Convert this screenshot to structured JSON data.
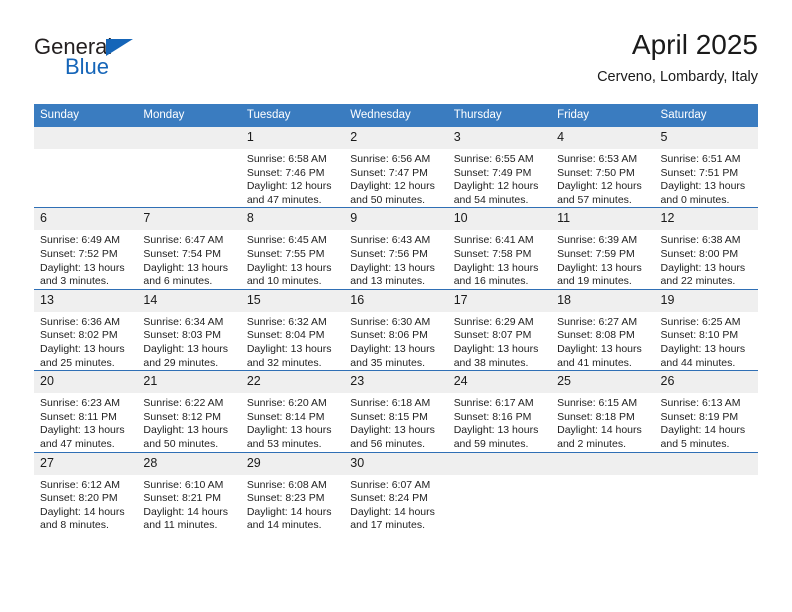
{
  "brand": {
    "name_part1": "General",
    "name_part2": "Blue",
    "triangle_color": "#1565b8"
  },
  "header": {
    "title": "April 2025",
    "subtitle": "Cerveno, Lombardy, Italy"
  },
  "theme": {
    "header_blue": "#3a7cc0",
    "divider_blue": "#2f6fb5",
    "daynum_band": "#efefef"
  },
  "weekday_headers": [
    "Sunday",
    "Monday",
    "Tuesday",
    "Wednesday",
    "Thursday",
    "Friday",
    "Saturday"
  ],
  "weeks": [
    [
      {
        "day": "",
        "sunrise": "",
        "sunset": "",
        "daylight1": "",
        "daylight2": ""
      },
      {
        "day": "",
        "sunrise": "",
        "sunset": "",
        "daylight1": "",
        "daylight2": ""
      },
      {
        "day": "1",
        "sunrise": "Sunrise: 6:58 AM",
        "sunset": "Sunset: 7:46 PM",
        "daylight1": "Daylight: 12 hours",
        "daylight2": "and 47 minutes."
      },
      {
        "day": "2",
        "sunrise": "Sunrise: 6:56 AM",
        "sunset": "Sunset: 7:47 PM",
        "daylight1": "Daylight: 12 hours",
        "daylight2": "and 50 minutes."
      },
      {
        "day": "3",
        "sunrise": "Sunrise: 6:55 AM",
        "sunset": "Sunset: 7:49 PM",
        "daylight1": "Daylight: 12 hours",
        "daylight2": "and 54 minutes."
      },
      {
        "day": "4",
        "sunrise": "Sunrise: 6:53 AM",
        "sunset": "Sunset: 7:50 PM",
        "daylight1": "Daylight: 12 hours",
        "daylight2": "and 57 minutes."
      },
      {
        "day": "5",
        "sunrise": "Sunrise: 6:51 AM",
        "sunset": "Sunset: 7:51 PM",
        "daylight1": "Daylight: 13 hours",
        "daylight2": "and 0 minutes."
      }
    ],
    [
      {
        "day": "6",
        "sunrise": "Sunrise: 6:49 AM",
        "sunset": "Sunset: 7:52 PM",
        "daylight1": "Daylight: 13 hours",
        "daylight2": "and 3 minutes."
      },
      {
        "day": "7",
        "sunrise": "Sunrise: 6:47 AM",
        "sunset": "Sunset: 7:54 PM",
        "daylight1": "Daylight: 13 hours",
        "daylight2": "and 6 minutes."
      },
      {
        "day": "8",
        "sunrise": "Sunrise: 6:45 AM",
        "sunset": "Sunset: 7:55 PM",
        "daylight1": "Daylight: 13 hours",
        "daylight2": "and 10 minutes."
      },
      {
        "day": "9",
        "sunrise": "Sunrise: 6:43 AM",
        "sunset": "Sunset: 7:56 PM",
        "daylight1": "Daylight: 13 hours",
        "daylight2": "and 13 minutes."
      },
      {
        "day": "10",
        "sunrise": "Sunrise: 6:41 AM",
        "sunset": "Sunset: 7:58 PM",
        "daylight1": "Daylight: 13 hours",
        "daylight2": "and 16 minutes."
      },
      {
        "day": "11",
        "sunrise": "Sunrise: 6:39 AM",
        "sunset": "Sunset: 7:59 PM",
        "daylight1": "Daylight: 13 hours",
        "daylight2": "and 19 minutes."
      },
      {
        "day": "12",
        "sunrise": "Sunrise: 6:38 AM",
        "sunset": "Sunset: 8:00 PM",
        "daylight1": "Daylight: 13 hours",
        "daylight2": "and 22 minutes."
      }
    ],
    [
      {
        "day": "13",
        "sunrise": "Sunrise: 6:36 AM",
        "sunset": "Sunset: 8:02 PM",
        "daylight1": "Daylight: 13 hours",
        "daylight2": "and 25 minutes."
      },
      {
        "day": "14",
        "sunrise": "Sunrise: 6:34 AM",
        "sunset": "Sunset: 8:03 PM",
        "daylight1": "Daylight: 13 hours",
        "daylight2": "and 29 minutes."
      },
      {
        "day": "15",
        "sunrise": "Sunrise: 6:32 AM",
        "sunset": "Sunset: 8:04 PM",
        "daylight1": "Daylight: 13 hours",
        "daylight2": "and 32 minutes."
      },
      {
        "day": "16",
        "sunrise": "Sunrise: 6:30 AM",
        "sunset": "Sunset: 8:06 PM",
        "daylight1": "Daylight: 13 hours",
        "daylight2": "and 35 minutes."
      },
      {
        "day": "17",
        "sunrise": "Sunrise: 6:29 AM",
        "sunset": "Sunset: 8:07 PM",
        "daylight1": "Daylight: 13 hours",
        "daylight2": "and 38 minutes."
      },
      {
        "day": "18",
        "sunrise": "Sunrise: 6:27 AM",
        "sunset": "Sunset: 8:08 PM",
        "daylight1": "Daylight: 13 hours",
        "daylight2": "and 41 minutes."
      },
      {
        "day": "19",
        "sunrise": "Sunrise: 6:25 AM",
        "sunset": "Sunset: 8:10 PM",
        "daylight1": "Daylight: 13 hours",
        "daylight2": "and 44 minutes."
      }
    ],
    [
      {
        "day": "20",
        "sunrise": "Sunrise: 6:23 AM",
        "sunset": "Sunset: 8:11 PM",
        "daylight1": "Daylight: 13 hours",
        "daylight2": "and 47 minutes."
      },
      {
        "day": "21",
        "sunrise": "Sunrise: 6:22 AM",
        "sunset": "Sunset: 8:12 PM",
        "daylight1": "Daylight: 13 hours",
        "daylight2": "and 50 minutes."
      },
      {
        "day": "22",
        "sunrise": "Sunrise: 6:20 AM",
        "sunset": "Sunset: 8:14 PM",
        "daylight1": "Daylight: 13 hours",
        "daylight2": "and 53 minutes."
      },
      {
        "day": "23",
        "sunrise": "Sunrise: 6:18 AM",
        "sunset": "Sunset: 8:15 PM",
        "daylight1": "Daylight: 13 hours",
        "daylight2": "and 56 minutes."
      },
      {
        "day": "24",
        "sunrise": "Sunrise: 6:17 AM",
        "sunset": "Sunset: 8:16 PM",
        "daylight1": "Daylight: 13 hours",
        "daylight2": "and 59 minutes."
      },
      {
        "day": "25",
        "sunrise": "Sunrise: 6:15 AM",
        "sunset": "Sunset: 8:18 PM",
        "daylight1": "Daylight: 14 hours",
        "daylight2": "and 2 minutes."
      },
      {
        "day": "26",
        "sunrise": "Sunrise: 6:13 AM",
        "sunset": "Sunset: 8:19 PM",
        "daylight1": "Daylight: 14 hours",
        "daylight2": "and 5 minutes."
      }
    ],
    [
      {
        "day": "27",
        "sunrise": "Sunrise: 6:12 AM",
        "sunset": "Sunset: 8:20 PM",
        "daylight1": "Daylight: 14 hours",
        "daylight2": "and 8 minutes."
      },
      {
        "day": "28",
        "sunrise": "Sunrise: 6:10 AM",
        "sunset": "Sunset: 8:21 PM",
        "daylight1": "Daylight: 14 hours",
        "daylight2": "and 11 minutes."
      },
      {
        "day": "29",
        "sunrise": "Sunrise: 6:08 AM",
        "sunset": "Sunset: 8:23 PM",
        "daylight1": "Daylight: 14 hours",
        "daylight2": "and 14 minutes."
      },
      {
        "day": "30",
        "sunrise": "Sunrise: 6:07 AM",
        "sunset": "Sunset: 8:24 PM",
        "daylight1": "Daylight: 14 hours",
        "daylight2": "and 17 minutes."
      },
      {
        "day": "",
        "sunrise": "",
        "sunset": "",
        "daylight1": "",
        "daylight2": ""
      },
      {
        "day": "",
        "sunrise": "",
        "sunset": "",
        "daylight1": "",
        "daylight2": ""
      },
      {
        "day": "",
        "sunrise": "",
        "sunset": "",
        "daylight1": "",
        "daylight2": ""
      }
    ]
  ]
}
